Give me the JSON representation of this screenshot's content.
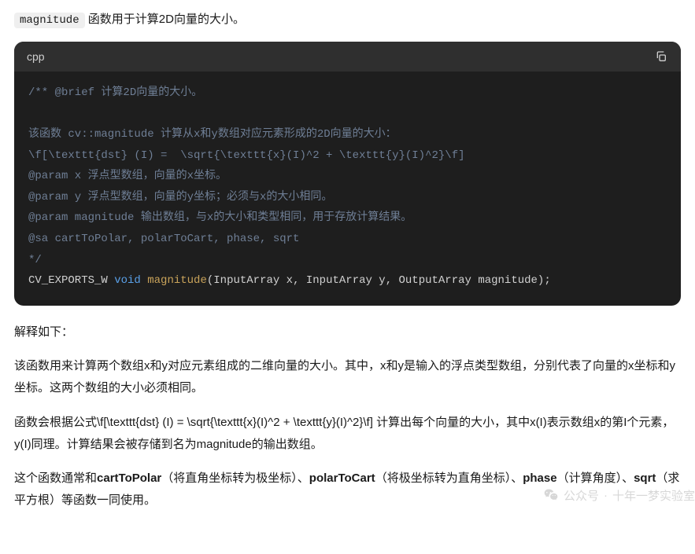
{
  "intro": {
    "code_token": "magnitude",
    "text_after": " 函数用于计算2D向量的大小。"
  },
  "code_block": {
    "language_label": "cpp",
    "lines": {
      "l1": "/** @brief 计算2D向量的大小。",
      "l2": "",
      "l3": "该函数 cv::magnitude 计算从x和y数组对应元素形成的2D向量的大小：",
      "l4": "\\f[\\texttt{dst} (I) =  \\sqrt{\\texttt{x}(I)^2 + \\texttt{y}(I)^2}\\f]",
      "l5": "@param x 浮点型数组，向量的x坐标。",
      "l6": "@param y 浮点型数组，向量的y坐标；必须与x的大小相同。",
      "l7": "@param magnitude 输出数组，与x的大小和类型相同，用于存放计算结果。",
      "l8": "@sa cartToPolar, polarToCart, phase, sqrt",
      "l9": "*/",
      "sig_prefix": "CV_EXPORTS_W ",
      "sig_kw": "void",
      "sig_space": " ",
      "sig_fn": "magnitude",
      "sig_rest": "(InputArray x, InputArray y, OutputArray magnitude);"
    }
  },
  "explanation": {
    "heading": "解释如下：",
    "p1": "该函数用来计算两个数组x和y对应元素组成的二维向量的大小。其中，x和y是输入的浮点类型数组，分别代表了向量的x坐标和y坐标。这两个数组的大小必须相同。",
    "p2": "函数会根据公式\\f[\\texttt{dst} (I) = \\sqrt{\\texttt{x}(I)^2 + \\texttt{y}(I)^2}\\f] 计算出每个向量的大小，其中x(I)表示数组x的第I个元素，y(I)同理。计算结果会被存储到名为magnitude的输出数组。",
    "p3_parts": {
      "a": "这个函数通常和",
      "b": "cartToPolar",
      "c": "（将直角坐标转为极坐标）、",
      "d": "polarToCart",
      "e": "（将极坐标转为直角坐标）、",
      "f": "phase",
      "g": "（计算角度）、",
      "h": "sqrt",
      "i": "（求平方根）等函数一同使用。"
    }
  },
  "watermark": {
    "label": "公众号",
    "dot": "·",
    "name": "十年一梦实验室"
  }
}
